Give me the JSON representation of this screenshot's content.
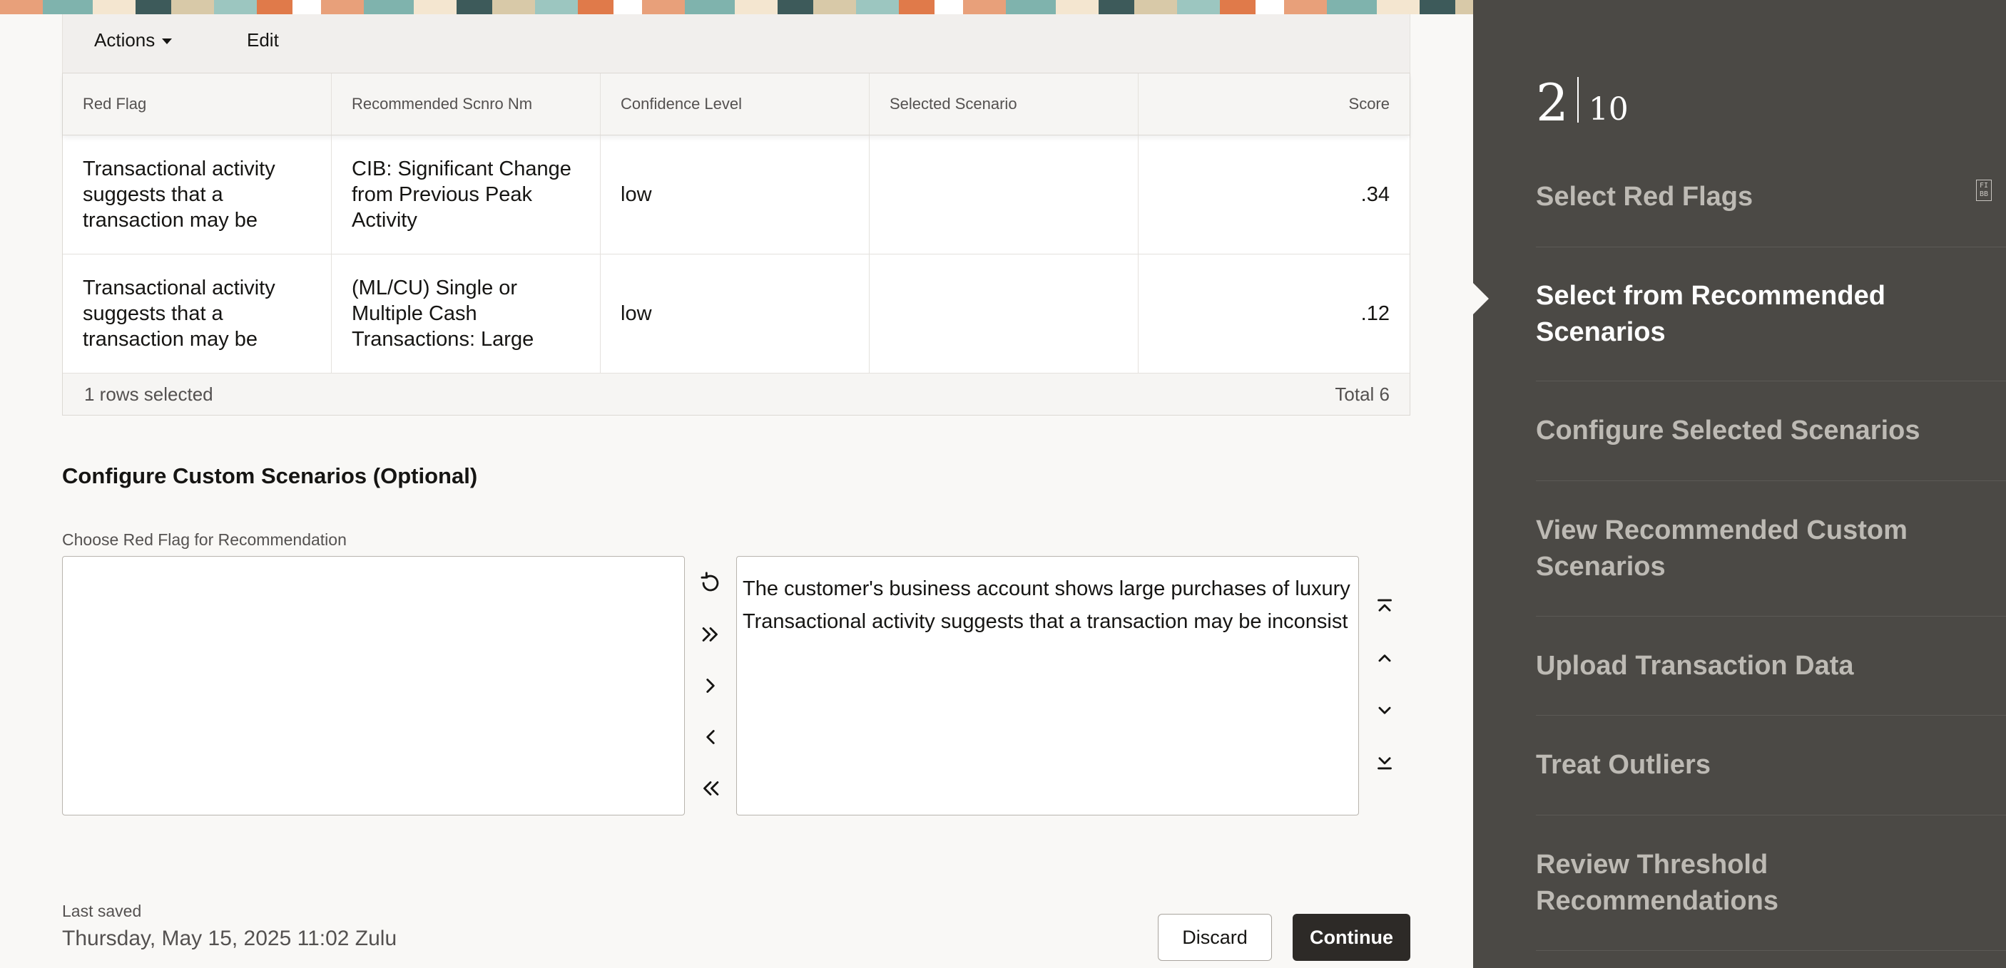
{
  "toolbar": {
    "actions_label": "Actions",
    "edit_label": "Edit"
  },
  "grid": {
    "columns": [
      "Red Flag",
      "Recommended Scnro Nm",
      "Confidence Level",
      "Selected Scenario",
      "Score"
    ],
    "rows": [
      {
        "red_flag": "Transactional activity suggests that a transaction may be",
        "scenario": "CIB: Significant Change from Previous Peak Activity",
        "confidence": "low",
        "selected": "",
        "score": ".34"
      },
      {
        "red_flag": "Transactional activity suggests that a transaction may be",
        "scenario": "(ML/CU) Single or Multiple Cash Transactions: Large",
        "confidence": "low",
        "selected": "",
        "score": ".12"
      }
    ],
    "footer_selected": "1 rows selected",
    "footer_total": "Total 6"
  },
  "custom": {
    "section_title": "Configure Custom Scenarios (Optional)",
    "field_label": "Choose Red Flag for Recommendation",
    "selected_items": [
      "The customer's business account shows large purchases of luxury",
      "Transactional activity suggests that a transaction may be inconsist"
    ]
  },
  "icons": {
    "reset": "reset-icon",
    "move_all_right": "double-chevron-right-icon",
    "move_right": "chevron-right-icon",
    "move_left": "chevron-left-icon",
    "move_all_left": "double-chevron-left-icon",
    "move_top": "move-to-top-icon",
    "move_up": "chevron-up-icon",
    "move_down": "chevron-down-icon",
    "move_bottom": "move-to-bottom-icon"
  },
  "save": {
    "label": "Last saved",
    "value": "Thursday, May 15, 2025 11:02 Zulu"
  },
  "buttons": {
    "discard": "Discard",
    "continue": "Continue"
  },
  "train": {
    "current": "2",
    "total": "10",
    "fi_icon_text": "FI\nBB",
    "steps": [
      "Select Red Flags",
      "Select from Recommended Scenarios",
      "Configure Selected Scenarios",
      "View Recommended Custom Scenarios",
      "Upload Transaction Data",
      "Treat Outliers",
      "Review Threshold Recommendations"
    ],
    "active_step": 1
  },
  "colors": {
    "train_bg": "#4b4945",
    "primary_button": "#2d2a27",
    "page_bg": "#f9f8f6"
  }
}
